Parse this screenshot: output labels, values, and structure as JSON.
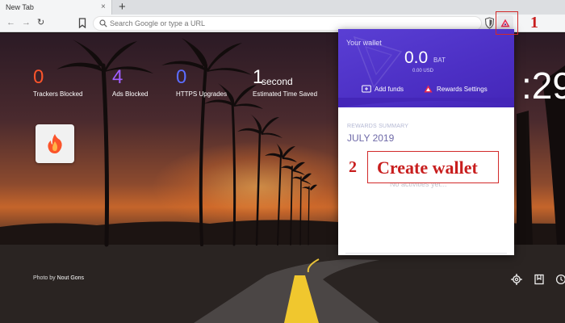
{
  "browser": {
    "tab_title": "New Tab",
    "tab_close": "×",
    "new_tab": "+",
    "nav_back": "←",
    "nav_forward": "→",
    "nav_reload": "↻",
    "omnibox_placeholder": "Search Google or type a URL"
  },
  "stats": [
    {
      "value": "0",
      "label": "Trackers Blocked",
      "color": "#fb542b"
    },
    {
      "value": "4",
      "label": "Ads Blocked",
      "color": "#a15eff"
    },
    {
      "value": "0",
      "label": "HTTPS Upgrades",
      "color": "#5b6cff"
    },
    {
      "value": "1",
      "unit": "second",
      "label": "Estimated Time Saved",
      "color": "#ffffff"
    }
  ],
  "clock": ":29",
  "photo_credit": {
    "prefix": "Photo by",
    "author": "Nout Gons"
  },
  "wallet": {
    "title": "Your wallet",
    "balance": "0.0",
    "currency": "BAT",
    "usd": "0.00 USD",
    "add_funds": "Add funds",
    "rewards_settings": "Rewards Settings"
  },
  "summary": {
    "label": "REWARDS SUMMARY",
    "month": "JULY 2019",
    "empty": "No activities yet..."
  },
  "annotations": {
    "step1": "1",
    "step2": "2",
    "create_wallet": "Create wallet"
  },
  "colors": {
    "brave_orange": "#fb542b",
    "rewards_purple": "#4c2fc4",
    "annotation_red": "#c81e1e"
  }
}
